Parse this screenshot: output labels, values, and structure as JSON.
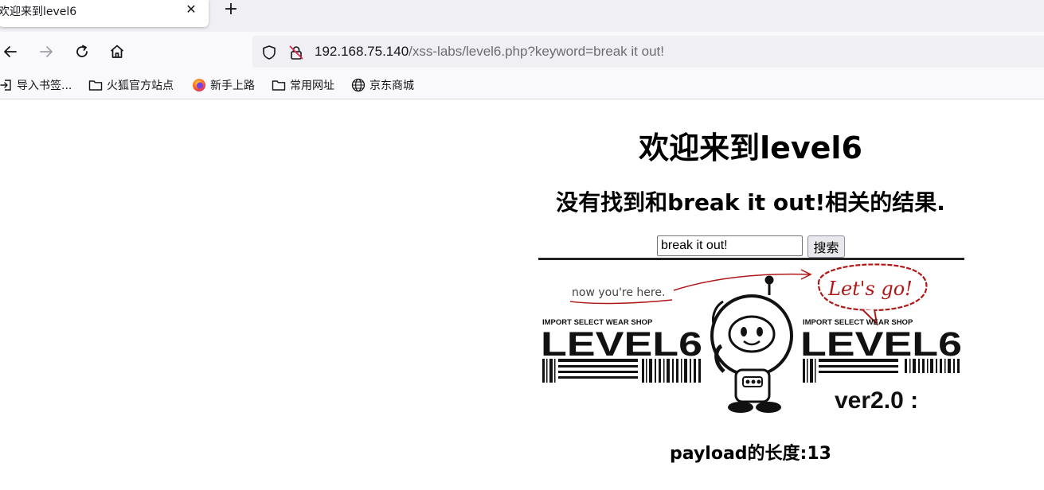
{
  "browser": {
    "tab": {
      "title": "欢迎来到level6"
    },
    "url": {
      "host": "192.168.75.140",
      "path": "/xss-labs/level6.php?keyword=break it out!"
    },
    "bookmarks": [
      {
        "label": "导入书签...",
        "icon": "import-icon"
      },
      {
        "label": "火狐官方站点",
        "icon": "folder-icon"
      },
      {
        "label": "新手上路",
        "icon": "firefox-icon"
      },
      {
        "label": "常用网址",
        "icon": "folder-icon"
      },
      {
        "label": "京东商城",
        "icon": "globe-icon"
      }
    ]
  },
  "page": {
    "title": "欢迎来到level6",
    "result": "没有找到和break it out!相关的结果.",
    "search": {
      "value": "break it out!",
      "button": "搜索"
    },
    "banner": {
      "tagline": "now you're here.",
      "callout": "Let's go!",
      "shop": "IMPORT SELECT WEAR SHOP",
      "level": "LEVEL6",
      "version": "ver2.0 :"
    },
    "payload_length": "payload的长度:13"
  },
  "colors": {
    "chrome_bg": "#f0f0f4",
    "toolbar_bg": "#f9f9fb",
    "sketch_red": "#b01818"
  }
}
